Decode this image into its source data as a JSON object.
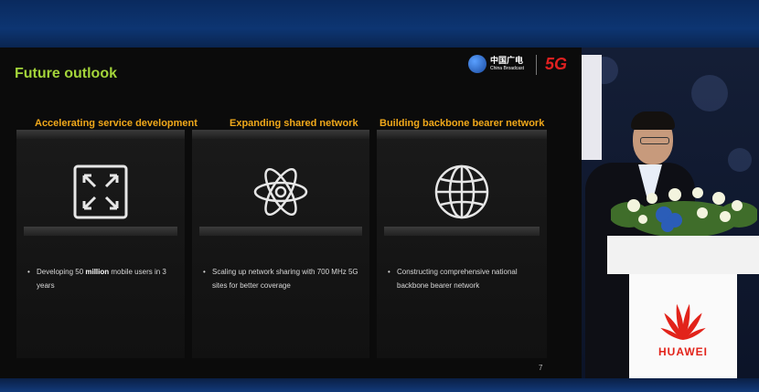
{
  "slide": {
    "title": "Future outlook",
    "logos": {
      "partner_cn": "中国广电",
      "partner_en": "China Broadcast",
      "badge": "5G"
    },
    "columns": [
      {
        "title": "Accelerating service development",
        "icon": "expand-arrows-icon",
        "bullet_pre": "Developing 50 ",
        "bullet_bold": "million",
        "bullet_post": " mobile users in 3 years"
      },
      {
        "title": "Expanding shared network",
        "icon": "atom-network-icon",
        "bullet": "Scaling up network sharing with 700 MHz 5G sites for better coverage"
      },
      {
        "title": "Building backbone bearer network",
        "icon": "globe-icon",
        "bullet": "Constructing comprehensive national backbone bearer network"
      }
    ],
    "page_number": "7"
  },
  "stage": {
    "podium_brand": "HUAWEI"
  },
  "colors": {
    "title_green": "#a3d43a",
    "column_orange": "#f0a81a",
    "huawei_red": "#e2231a"
  }
}
